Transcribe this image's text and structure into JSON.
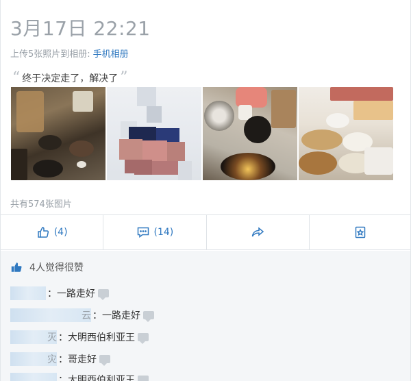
{
  "post": {
    "date": "3月17日 22:21",
    "upload_prefix": "上传5张照片到相册:",
    "album_link": "手机相册",
    "quote_text": "终于决定走了，解决了",
    "photo_count": "共有574张图片"
  },
  "actions": {
    "like_count": "(4)",
    "comment_count": "(14)"
  },
  "likes": {
    "summary": "4人觉得很赞"
  },
  "comments": [
    {
      "name_partial": "",
      "text": "：一路走好"
    },
    {
      "name_partial": "云",
      "text": "：一路走好"
    },
    {
      "name_partial": "灭",
      "text": "：大明西伯利亚王"
    },
    {
      "name_partial": "灾",
      "text": "：哥走好"
    },
    {
      "name_partial": "",
      "text": "：大明西伯利亚王"
    }
  ],
  "colors": {
    "accent": "#2f78c0",
    "muted": "#9aa1a8"
  },
  "icons": [
    "thumbs-up-icon",
    "comment-icon",
    "share-icon",
    "bookmark-icon",
    "like-hand-icon",
    "bubble-icon"
  ]
}
